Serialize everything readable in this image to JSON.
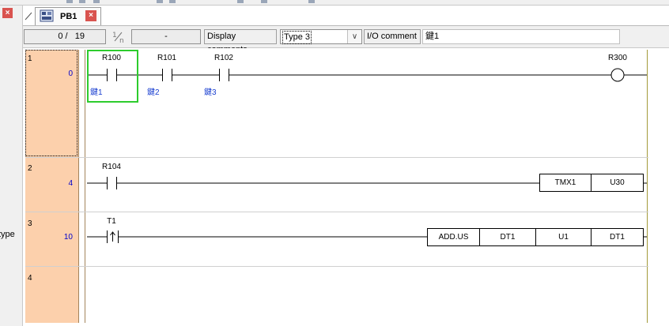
{
  "left_panel": {
    "close_icon": "×",
    "partial_text": "type"
  },
  "tab": {
    "label": "PB1",
    "close_icon": "×"
  },
  "toolbar": {
    "position_current": "0",
    "position_total": "19",
    "position_sep": "/",
    "range_value": "-",
    "display_comments_label": "Display comments",
    "comment_type_selected": "Type 3",
    "io_comment_label": "I/O comment",
    "io_comment_value": "鍵1"
  },
  "rungs": [
    {
      "row": "1",
      "step": "0"
    },
    {
      "row": "2",
      "step": "4"
    },
    {
      "row": "3",
      "step": "10"
    },
    {
      "row": "4",
      "step": ""
    }
  ],
  "devices": {
    "r100": "R100",
    "r101": "R101",
    "r102": "R102",
    "r300": "R300",
    "r104": "R104",
    "t1": "T1",
    "c_r100": "鍵1",
    "c_r101": "鍵2",
    "c_r102": "鍵3"
  },
  "instructions": {
    "tmx": "TMX1",
    "u30": "U30",
    "add": "ADD.US",
    "dt1a": "DT1",
    "u1": "U1",
    "dt1b": "DT1"
  },
  "colors": {
    "accent_selection": "#2dcc2d",
    "step_column": "#fcd0ac",
    "comment_text": "#1a3fd0"
  }
}
